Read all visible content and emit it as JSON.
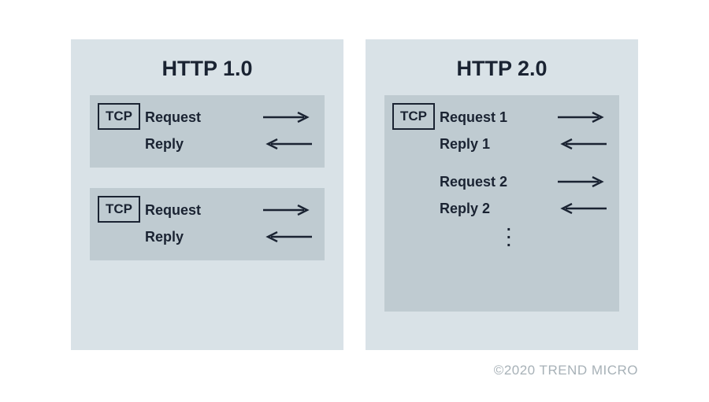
{
  "copyright": "©2020 TREND MICRO",
  "panels": {
    "left": {
      "title": "HTTP 1.0",
      "blocks": [
        {
          "tcp_label": "TCP",
          "rows": [
            {
              "label": "Request",
              "dir": "right"
            },
            {
              "label": "Reply",
              "dir": "left"
            }
          ]
        },
        {
          "tcp_label": "TCP",
          "rows": [
            {
              "label": "Request",
              "dir": "right"
            },
            {
              "label": "Reply",
              "dir": "left"
            }
          ]
        }
      ]
    },
    "right": {
      "title": "HTTP 2.0",
      "block": {
        "tcp_label": "TCP",
        "groups": [
          [
            {
              "label": "Request 1",
              "dir": "right"
            },
            {
              "label": "Reply 1",
              "dir": "left"
            }
          ],
          [
            {
              "label": "Request 2",
              "dir": "right"
            },
            {
              "label": "Reply 2",
              "dir": "left"
            }
          ]
        ],
        "ellipsis": "⋮"
      }
    }
  }
}
